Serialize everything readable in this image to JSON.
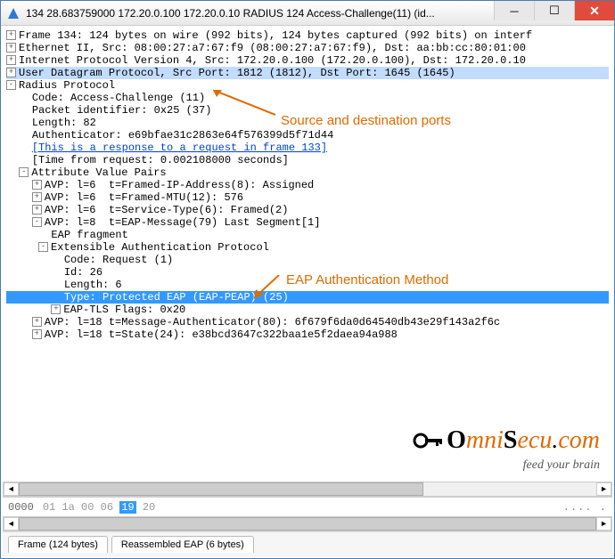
{
  "titlebar": {
    "title": "134 28.683759000 172.20.0.100 172.20.0.10 RADIUS 124 Access-Challenge(11) (id..."
  },
  "tree": {
    "frame": "Frame 134: 124 bytes on wire (992 bits), 124 bytes captured (992 bits) on interf",
    "eth": "Ethernet II, Src: 08:00:27:a7:67:f9 (08:00:27:a7:67:f9), Dst: aa:bb:cc:80:01:00",
    "ip": "Internet Protocol Version 4, Src: 172.20.0.100 (172.20.0.100), Dst: 172.20.0.10",
    "udp": "User Datagram Protocol, Src Port: 1812 (1812), Dst Port: 1645 (1645)",
    "radius": {
      "title": "Radius Protocol",
      "code": "Code: Access-Challenge (11)",
      "pktid": "Packet identifier: 0x25 (37)",
      "length": "Length: 82",
      "auth": "Authenticator: e69bfae31c2863e64f576399d5f71d44",
      "respref": "[This is a response to a request in frame 133]",
      "time": "[Time from request: 0.002108000 seconds]",
      "avp_title": "Attribute Value Pairs"
    },
    "avps": [
      "AVP: l=6  t=Framed-IP-Address(8): Assigned",
      "AVP: l=6  t=Framed-MTU(12): 576",
      "AVP: l=6  t=Service-Type(6): Framed(2)",
      "AVP: l=8  t=EAP-Message(79) Last Segment[1]",
      "AVP: l=18 t=Message-Authenticator(80): 6f679f6da0d64540db43e29f143a2f6c",
      "AVP: l=18 t=State(24): e38bcd3647c322baa1e5f2daea94a988"
    ],
    "eap": {
      "frag": "EAP fragment",
      "title": "Extensible Authentication Protocol",
      "code": "Code: Request (1)",
      "id": "Id: 26",
      "length": "Length: 6",
      "type": "Type: Protected EAP (EAP-PEAP) (25)",
      "tlsflags": "EAP-TLS Flags: 0x20"
    }
  },
  "annotations": [
    "Source and destination ports",
    "EAP Authentication Method"
  ],
  "hex": {
    "offset": "0000",
    "bytes_pre": "01 1a 00 06 ",
    "byte_sel": "19",
    "bytes_post": " 20",
    "ascii": ".... . "
  },
  "tabs": [
    "Frame (124 bytes)",
    "Reassembled EAP (6 bytes)"
  ],
  "logo": {
    "tagline": "feed your brain"
  }
}
